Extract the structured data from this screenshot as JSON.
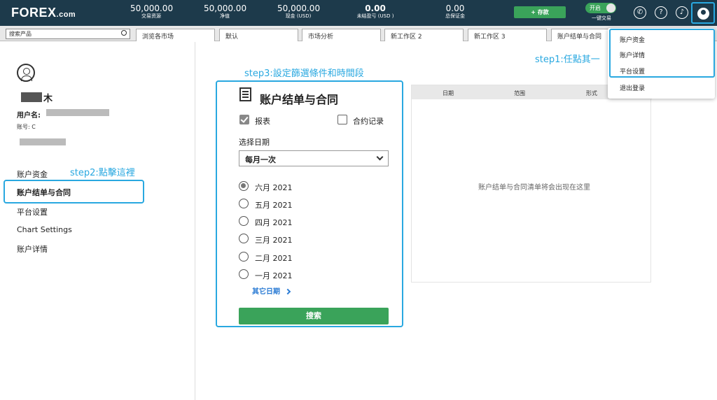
{
  "topbar": {
    "logo": "FOREX",
    "logo_suffix": ".com",
    "stats": [
      {
        "value": "50,000.00",
        "label": "交易资源"
      },
      {
        "value": "50,000.00",
        "label": "净值"
      },
      {
        "value": "50,000.00",
        "label": "现金 (USD)"
      },
      {
        "value": "0.00",
        "label": "未结盈亏 (USD )"
      },
      {
        "value": "0.00",
        "label": "总保证金"
      }
    ],
    "deposit_label": "+ 存款",
    "toggle_state": "开启",
    "toggle_label": "一键交易",
    "icons": [
      "phone-icon",
      "help-icon",
      "bell-icon",
      "user-icon"
    ]
  },
  "tabbar": {
    "search_placeholder": "搜索产品",
    "tabs": [
      "浏览各市场",
      "默认",
      "市场分析",
      "新工作区 2",
      "新工作区 3",
      "账户结单与合同"
    ]
  },
  "left": {
    "name_suffix": "木",
    "username_label": "用户名:",
    "account_label": "账号: C",
    "menu": [
      "账户资金",
      "账户结单与合同",
      "平台设置",
      "Chart Settings",
      "账户详情"
    ],
    "active_index": 1
  },
  "annotations": {
    "step1": "step1:任點其一",
    "step2": "step2:點擊這裡",
    "step3": "step3:設定篩選條件和時間段"
  },
  "filter": {
    "title": "账户结单与合同",
    "check_statements": "报表",
    "check_contracts": "合约记录",
    "statements_checked": true,
    "contracts_checked": false,
    "date_label": "选择日期",
    "frequency": "每月一次",
    "months": [
      "六月 2021",
      "五月 2021",
      "四月 2021",
      "三月 2021",
      "二月 2021",
      "一月 2021"
    ],
    "selected_month_index": 0,
    "more_dates": "其它日期",
    "search_button": "搜索"
  },
  "table": {
    "headers": [
      "日期",
      "范围",
      "形式"
    ],
    "empty_message": "账户结单与合同清单将会出现在这里"
  },
  "dropdown": {
    "items": [
      "账户资金",
      "账户详情",
      "平台设置",
      "退出登录"
    ]
  },
  "colors": {
    "topbar": "#1d3a4b",
    "accent_green": "#3aa35a",
    "annotation_blue": "#29a8e0"
  }
}
